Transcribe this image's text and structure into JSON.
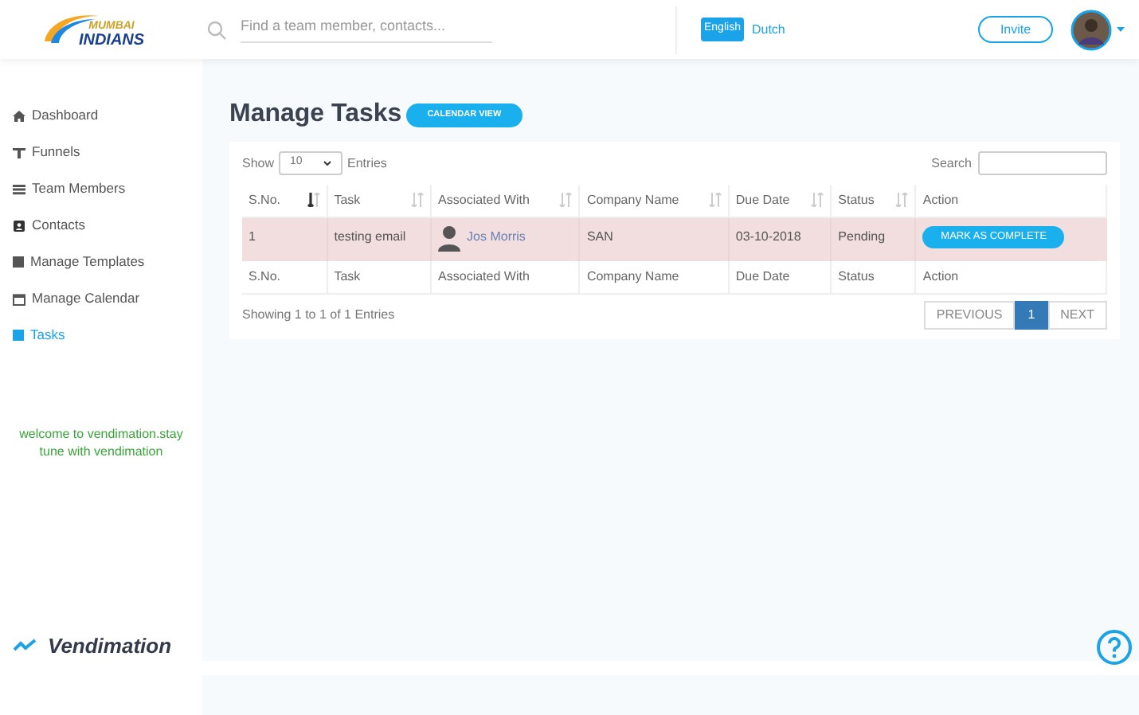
{
  "logo": {
    "line_1": "MUMBAI",
    "line_2": "INDIANS"
  },
  "search": {
    "placeholder": "Find a team member, contacts..."
  },
  "languages": [
    {
      "label": "English",
      "selected": true
    },
    {
      "label": "Dutch",
      "selected": false
    }
  ],
  "invite": "Invite",
  "sidebar": {
    "items": [
      {
        "label": "Dashboard",
        "selected": false
      },
      {
        "label": "Funnels",
        "selected": false
      },
      {
        "label": "Team Members",
        "selected": false
      },
      {
        "label": "Contacts",
        "selected": false
      },
      {
        "label": "Manage Templates",
        "selected": false
      },
      {
        "label": "Manage Calendar",
        "selected": false
      },
      {
        "label": "Tasks",
        "selected": true
      }
    ],
    "welcome": "welcome to vendimation.stay tune with vendimation",
    "brand": "Vendimation"
  },
  "page": {
    "title": "Manage Tasks",
    "calendar_button": "CALENDAR VIEW"
  },
  "length": {
    "show": "Show",
    "value": "10",
    "entries": "Entries"
  },
  "table_search": {
    "label": "Search"
  },
  "table": {
    "columns": [
      {
        "label": "S.No.",
        "sortable": true,
        "sorted": true
      },
      {
        "label": "Task",
        "sortable": true,
        "sorted": false
      },
      {
        "label": "Associated With",
        "sortable": true,
        "sorted": false
      },
      {
        "label": "Company Name",
        "sortable": true,
        "sorted": false
      },
      {
        "label": "Due Date",
        "sortable": true,
        "sorted": false
      },
      {
        "label": "Status",
        "sortable": true,
        "sorted": false
      },
      {
        "label": "Action",
        "sortable": false
      }
    ],
    "rows": [
      {
        "sno": "1",
        "task": "testing email",
        "associated": "Jos Morris",
        "company": "SAN",
        "due": "03-10-2018",
        "status": "Pending",
        "action": "MARK AS COMPLETE"
      }
    ],
    "footer": [
      "S.No.",
      "Task",
      "Associated With",
      "Company Name",
      "Due Date",
      "Status",
      "Action"
    ]
  },
  "info": "Showing 1 to 1 of 1 Entries",
  "pagination": [
    {
      "label": "PREVIOUS",
      "selected": false
    },
    {
      "label": "1",
      "selected": true
    },
    {
      "label": "NEXT",
      "selected": false
    }
  ]
}
